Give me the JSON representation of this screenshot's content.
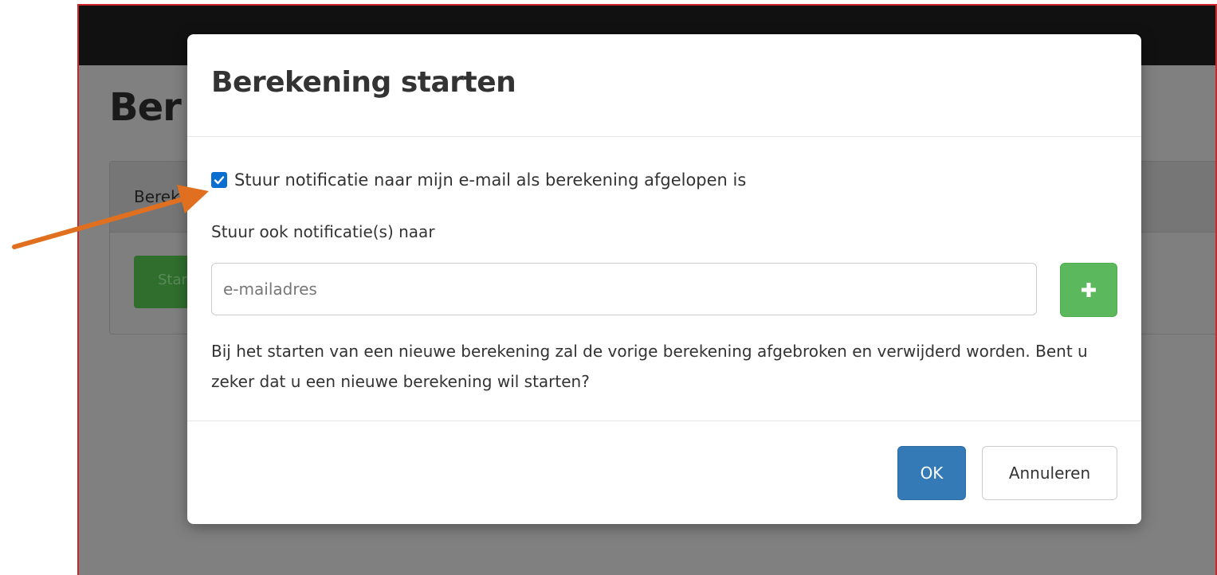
{
  "background": {
    "page_title_partial": "Ber",
    "panel_heading_partial": "Berek",
    "start_button_partial": "Star"
  },
  "modal": {
    "title": "Berekening starten",
    "notify_checkbox": {
      "checked": true,
      "label": "Stuur notificatie naar mijn e-mail als berekening afgelopen is"
    },
    "also_notify_label": "Stuur ook notificatie(s) naar",
    "email_input": {
      "value": "",
      "placeholder": "e-mailadres"
    },
    "add_button_icon": "plus-icon",
    "warning": "Bij het starten van een nieuwe berekening zal de vorige berekening afgebroken en verwijderd worden. Bent u zeker dat u een nieuwe berekening wil starten?",
    "ok_label": "OK",
    "cancel_label": "Annuleren"
  },
  "annotation": {
    "arrow_color": "#e07020",
    "points_to": "notify-checkbox"
  },
  "colors": {
    "primary": "#337ab7",
    "success": "#5cb85c",
    "checkbox": "#0a6ed1",
    "backdrop": "#808080",
    "frame_border": "#d0262b"
  }
}
